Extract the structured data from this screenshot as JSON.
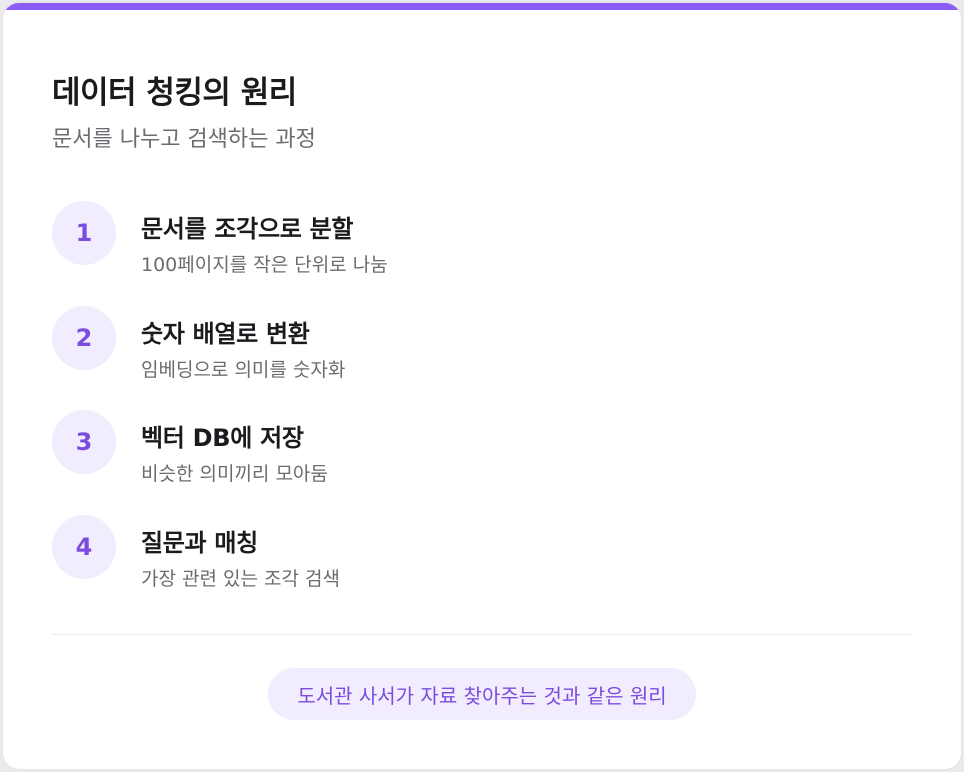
{
  "header": {
    "title": "데이터 청킹의 원리",
    "subtitle": "문서를 나누고 검색하는 과정"
  },
  "steps": [
    {
      "number": "1",
      "title": "문서를 조각으로 분할",
      "description": "100페이지를 작은 단위로 나눔"
    },
    {
      "number": "2",
      "title": "숫자 배열로 변환",
      "description": "임베딩으로 의미를 숫자화"
    },
    {
      "number": "3",
      "title": "벡터 DB에 저장",
      "description": "비슷한 의미끼리 모아둠"
    },
    {
      "number": "4",
      "title": "질문과 매칭",
      "description": "가장 관련 있는 조각 검색"
    }
  ],
  "footer": {
    "note": "도서관 사서가 자료 찾아주는 것과 같은 원리"
  },
  "colors": {
    "accent": "#8b5cf6",
    "accent_text": "#7c4ddd",
    "accent_soft": "#f1ecfe"
  }
}
